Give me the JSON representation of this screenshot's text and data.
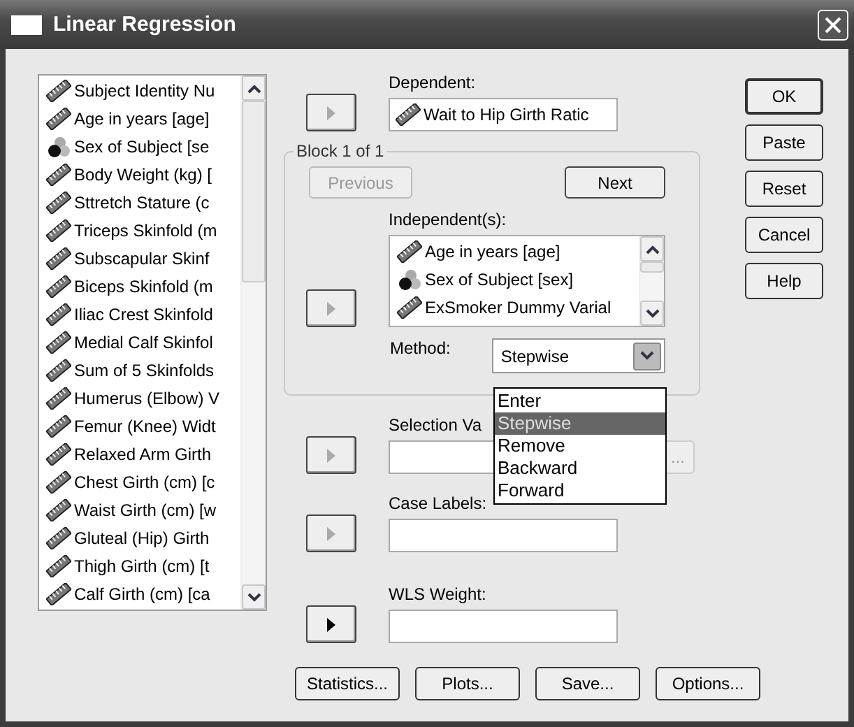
{
  "window": {
    "title": "Linear Regression"
  },
  "variables": [
    {
      "label": "Subject Identity Nu",
      "kind": "scale"
    },
    {
      "label": "Age in years [age]",
      "kind": "scale"
    },
    {
      "label": "Sex of Subject [se",
      "kind": "nominal"
    },
    {
      "label": "Body Weight (kg) [",
      "kind": "scale"
    },
    {
      "label": "Sttretch Stature (c",
      "kind": "scale"
    },
    {
      "label": "Triceps Skinfold (m",
      "kind": "scale"
    },
    {
      "label": "Subscapular Skinf",
      "kind": "scale"
    },
    {
      "label": "Biceps Skinfold (m",
      "kind": "scale"
    },
    {
      "label": "Iliac Crest Skinfold",
      "kind": "scale"
    },
    {
      "label": "Medial Calf Skinfol",
      "kind": "scale"
    },
    {
      "label": "Sum of 5 Skinfolds",
      "kind": "scale"
    },
    {
      "label": "Humerus (Elbow) V",
      "kind": "scale"
    },
    {
      "label": "Femur (Knee) Widt",
      "kind": "scale"
    },
    {
      "label": "Relaxed Arm Girth",
      "kind": "scale"
    },
    {
      "label": "Chest Girth (cm) [c",
      "kind": "scale"
    },
    {
      "label": "Waist Girth (cm) [w",
      "kind": "scale"
    },
    {
      "label": "Gluteal (Hip) Girth",
      "kind": "scale"
    },
    {
      "label": "Thigh Girth (cm) [t",
      "kind": "scale"
    },
    {
      "label": "Calf Girth (cm) [ca",
      "kind": "scale"
    }
  ],
  "dependent": {
    "label": "Dependent:",
    "arrow_enabled": false,
    "value": {
      "label": "Wait to Hip Girth Ratic",
      "kind": "scale"
    }
  },
  "block": {
    "title": "Block 1 of 1",
    "previous": {
      "label": "Previous",
      "disabled": true
    },
    "next": {
      "label": "Next",
      "disabled": false
    },
    "independents": {
      "label": "Independent(s):",
      "arrow_enabled": false,
      "items": [
        {
          "label": "Age in years [age]",
          "kind": "scale"
        },
        {
          "label": "Sex of Subject [sex]",
          "kind": "nominal"
        },
        {
          "label": "ExSmoker Dummy Varial",
          "kind": "scale"
        }
      ]
    },
    "method": {
      "label": "Method:",
      "value": "Stepwise",
      "expanded": true,
      "options": [
        {
          "label": "Enter",
          "selected": false
        },
        {
          "label": "Stepwise",
          "selected": true
        },
        {
          "label": "Remove",
          "selected": false
        },
        {
          "label": "Backward",
          "selected": false
        },
        {
          "label": "Forward",
          "selected": false
        }
      ]
    }
  },
  "selection": {
    "label": "Selection Va",
    "arrow_enabled": false,
    "rule_button": "..."
  },
  "case_labels": {
    "label": "Case Labels:",
    "arrow_enabled": false
  },
  "wls_weight": {
    "label": "WLS Weight:",
    "arrow_enabled": true
  },
  "side_buttons": [
    {
      "label": "OK",
      "default": true
    },
    {
      "label": "Paste",
      "default": false
    },
    {
      "label": "Reset",
      "default": false
    },
    {
      "label": "Cancel",
      "default": false
    },
    {
      "label": "Help",
      "default": false
    }
  ],
  "bottom_buttons": [
    {
      "label": "Statistics..."
    },
    {
      "label": "Plots..."
    },
    {
      "label": "Save..."
    },
    {
      "label": "Options..."
    }
  ]
}
